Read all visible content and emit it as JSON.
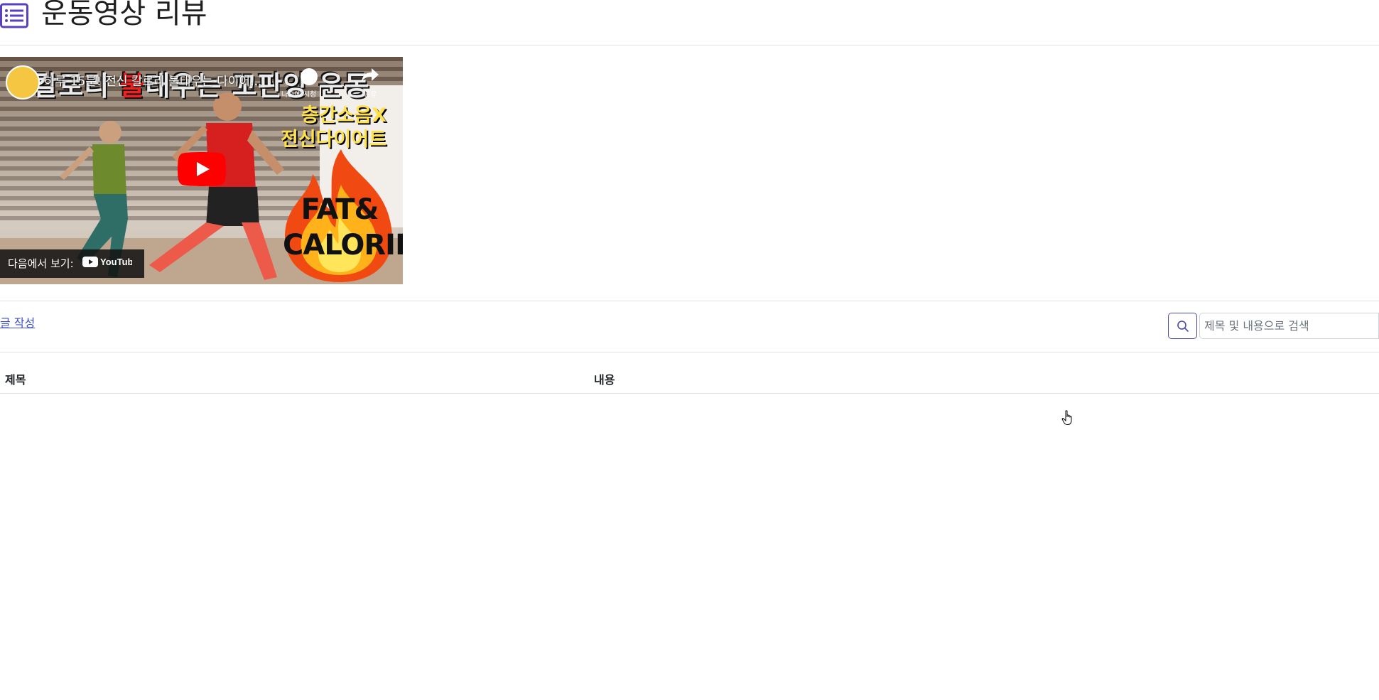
{
  "header": {
    "title": "운동영상 리뷰",
    "icon": "list-icon",
    "accent_color": "#5a3fc0"
  },
  "video": {
    "thumbnail_headline_parts": [
      "칼로리 ",
      "불",
      "태우는 꼬판앙 운동"
    ],
    "title": "하루 15분! 전신 칼로리 불태우는 다이어...",
    "watch_later_label": "나중에 시청",
    "share_label": "공유",
    "overlay_lines": [
      "층간소음X",
      "전신다이어트"
    ],
    "fire_text_lines": [
      "FAT&",
      "CALORIE"
    ],
    "watch_on_label": "다음에서 보기:",
    "platform": "YouTube"
  },
  "toolbar": {
    "write_link": "글 작성",
    "search_placeholder": "제목 및 내용으로 검색",
    "search_value": ""
  },
  "table": {
    "columns": [
      "제목",
      "내용"
    ],
    "rows": []
  }
}
